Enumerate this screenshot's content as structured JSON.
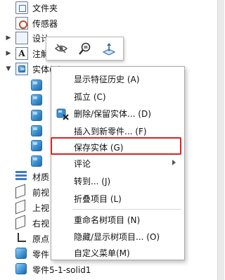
{
  "tree": {
    "items": [
      {
        "label": "文件夹",
        "icon": "folder-icon"
      },
      {
        "label": "传感器",
        "icon": "sensor-icon"
      },
      {
        "label": "设计",
        "icon": "design-binder-icon"
      },
      {
        "label": "注解",
        "icon": "annotations-icon"
      },
      {
        "label": "实体(6)",
        "icon": "solid-bodies-folder-icon"
      },
      {
        "label": "材质",
        "icon": "material-icon"
      },
      {
        "label": "前视",
        "icon": "front-plane-icon"
      },
      {
        "label": "上视",
        "icon": "top-plane-icon"
      },
      {
        "label": "右视",
        "icon": "right-plane-icon"
      },
      {
        "label": "原点",
        "icon": "origin-icon"
      },
      {
        "label": "零件",
        "icon": "part-icon"
      },
      {
        "label": "零件5-1-solid1",
        "icon": "part-icon"
      }
    ],
    "note_glyph": "A"
  },
  "toolbar": {
    "buttons": [
      {
        "name": "hide-show-icon"
      },
      {
        "name": "zoom-to-selection-icon"
      },
      {
        "name": "normal-to-icon"
      }
    ]
  },
  "context_menu": {
    "items": [
      {
        "label": "显示特征历史 (A)"
      },
      {
        "label": "孤立 (C)"
      },
      {
        "label": "删除/保留实体... (D)"
      },
      {
        "label": "插入到新零件... (F)"
      },
      {
        "label": "保存实体 (G)"
      },
      {
        "label": "评论"
      },
      {
        "label": "转到... (J)"
      },
      {
        "label": "折叠项目 (L)"
      },
      {
        "label": "重命名树项目 (N)"
      },
      {
        "label": "隐藏/显示树项目... (O)"
      },
      {
        "label": "自定义菜单(M)"
      }
    ],
    "highlighted": "保存实体 (G)",
    "highlight_color": "#e02020"
  }
}
